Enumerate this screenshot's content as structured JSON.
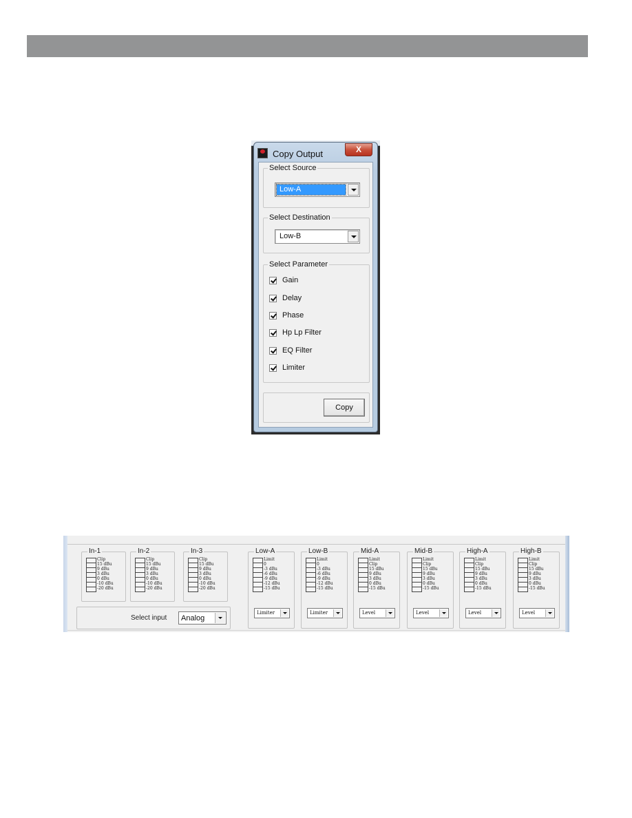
{
  "dialog": {
    "title": "Copy Output",
    "close_label": "X",
    "source": {
      "group_label": "Select Source",
      "selected": "Low-A"
    },
    "destination": {
      "group_label": "Select Destination",
      "selected": "Low-B"
    },
    "parameters": {
      "group_label": "Select Parameter",
      "items": [
        {
          "label": "Gain",
          "checked": true
        },
        {
          "label": "Delay",
          "checked": true
        },
        {
          "label": "Phase",
          "checked": true
        },
        {
          "label": "Hp Lp Filter",
          "checked": true
        },
        {
          "label": "EQ Filter",
          "checked": true
        },
        {
          "label": "Limiter",
          "checked": true
        }
      ]
    },
    "copy_button": "Copy"
  },
  "meters": {
    "inputs": [
      {
        "name": "In-1",
        "levels": [
          "Clip",
          "15 dBu",
          "9 dBu",
          "3 dBu",
          "0 dBu",
          "-10 dBu",
          "-20 dBu"
        ]
      },
      {
        "name": "In-2",
        "levels": [
          "Clip",
          "15 dBu",
          "9 dBu",
          "3 dBu",
          "0 dBu",
          "-10 dBu",
          "-20 dBu"
        ]
      },
      {
        "name": "In-3",
        "levels": [
          "Clip",
          "15 dBu",
          "9 dBu",
          "3 dBu",
          "0 dBu",
          "-10 dBu",
          "-20 dBu"
        ]
      }
    ],
    "select_input": {
      "label": "Select input",
      "value": "Analog"
    },
    "outputs": [
      {
        "name": "Low-A",
        "levels": [
          "Limit",
          "0",
          "-3 dBu",
          "-6 dBu",
          "-9 dBu",
          "-12 dBu",
          "-15 dBu"
        ],
        "mode": "Limiter"
      },
      {
        "name": "Low-B",
        "levels": [
          "Limit",
          "0",
          "-3 dBu",
          "-6 dBu",
          "-9 dBu",
          "-12 dBu",
          "-15 dBu"
        ],
        "mode": "Limiter"
      },
      {
        "name": "Mid-A",
        "levels": [
          "Limit",
          "Clip",
          "15 dBu",
          "9 dBu",
          "3 dBu",
          "0 dBu",
          "-15 dBu"
        ],
        "mode": "Level"
      },
      {
        "name": "Mid-B",
        "levels": [
          "Limit",
          "Clip",
          "15 dBu",
          "9 dBu",
          "3 dBu",
          "0 dBu",
          "-15 dBu"
        ],
        "mode": "Level"
      },
      {
        "name": "High-A",
        "levels": [
          "Limit",
          "Clip",
          "15 dBu",
          "9 dBu",
          "3 dBu",
          "0 dBu",
          "-15 dBu"
        ],
        "mode": "Level"
      },
      {
        "name": "High-B",
        "levels": [
          "Limit",
          "Clip",
          "15 dBu",
          "9 dBu",
          "3 dBu",
          "0 dBu",
          "-15 dBu"
        ],
        "mode": "Level"
      }
    ]
  },
  "colors": {
    "header_bar": "#939495",
    "selection": "#3399ff",
    "close_button": "#c8503a"
  }
}
